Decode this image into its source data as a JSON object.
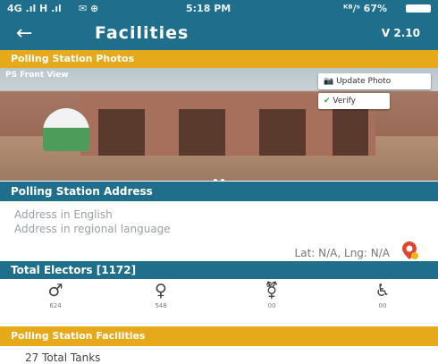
{
  "status_bar": {
    "left": "4G .ıl H .ıl",
    "time": "5:18 PM",
    "right": "ᴷᴮ/ˢ 67%"
  },
  "app_bar": {
    "back_icon": "arrow-left-icon",
    "title": "Facilities",
    "version": "V 2.10"
  },
  "photos_section": {
    "header": "Polling Station Photos",
    "photo_label": "PS Front View",
    "update_button": "Update Photo",
    "verify_button": "Verify"
  },
  "address_section": {
    "header": "Polling Station Address",
    "address_english": "Address in English",
    "address_regional": "Address in regional language",
    "lat_lng": "Lat: N/A, Lng: N/A",
    "location_icon": "map-pin-icon"
  },
  "electors": {
    "header": "Total Electors [1172]",
    "stats": [
      {
        "icon": "male-icon",
        "value": "624"
      },
      {
        "icon": "female-icon",
        "value": "548"
      },
      {
        "icon": "transgender-icon",
        "value": "00"
      },
      {
        "icon": "wheelchair-icon",
        "value": "00"
      }
    ]
  },
  "facilities_section": {
    "header": "Polling Station Facilities",
    "first_item": "27 Total Tanks"
  },
  "colors": {
    "primary": "#1f6e8c",
    "accent": "#e6a91a"
  }
}
